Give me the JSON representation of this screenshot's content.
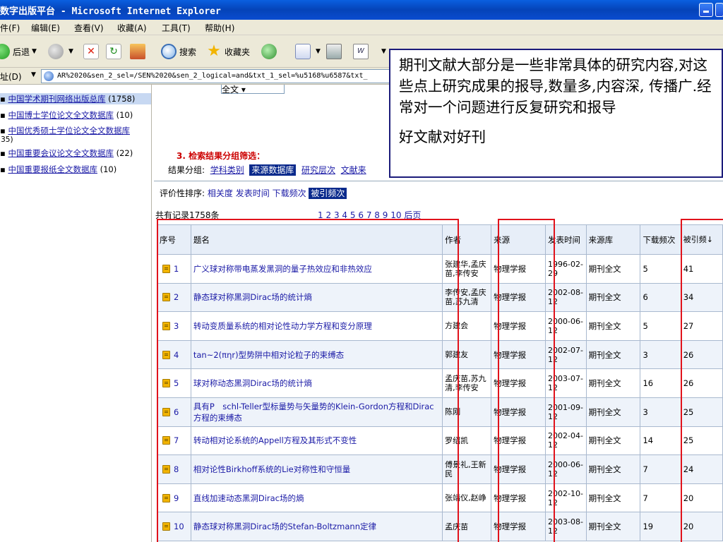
{
  "window": {
    "title": "数字出版平台 - Microsoft Internet Explorer"
  },
  "menu": [
    "件(F)",
    "编辑(E)",
    "查看(V)",
    "收藏(A)",
    "工具(T)",
    "帮助(H)"
  ],
  "toolbar": {
    "back_label": "后退",
    "search_label": "搜索",
    "favorites_label": "收藏夹"
  },
  "address": {
    "label": "址(D)",
    "url": "AR%2020&sen_2_sel=/SEN%2020&sen_2_logical=and&txt_1_sel=%u5168%u6587&txt_"
  },
  "sidebar": {
    "items": [
      {
        "label": "中国学术期刊网络出版总库",
        "count": "(1758)",
        "selected": true
      },
      {
        "label": "中国博士学位论文全文数据库",
        "count": "(10)"
      },
      {
        "label": "中国优秀硕士学位论文全文数据库",
        "count": "(35)"
      },
      {
        "label": "中国重要会议论文全文数据库",
        "count": "(22)"
      },
      {
        "label": "中国重要报纸全文数据库",
        "count": "(10)"
      }
    ]
  },
  "filter": {
    "select_value": "全文",
    "group_title": "3. 检索结果分组筛选：",
    "group_label": "结果分组:",
    "group_items": [
      "学科类别",
      "来源数据库",
      "研究层次",
      "文献来"
    ],
    "group_active": "来源数据库"
  },
  "sort": {
    "label": "评价性排序:",
    "options": [
      "相关度",
      "发表时间",
      "下载频次",
      "被引频次"
    ],
    "active": "被引频次"
  },
  "results": {
    "count_text": "共有记录1758条",
    "pages": [
      "1",
      "2",
      "3",
      "4",
      "5",
      "6",
      "7",
      "8",
      "9",
      "10"
    ],
    "next_label": "后页",
    "headers": [
      "序号",
      "题名",
      "作者",
      "来源",
      "发表时间",
      "来源库",
      "下载频次",
      "被引频↓"
    ],
    "rows": [
      {
        "no": "1",
        "title": "广义球对称带电蒸发黑洞的量子热效应和非热效应",
        "author": "张建华,孟庆苗,李传安",
        "source": "物理学报",
        "date": "1996-02-29",
        "db": "期刊全文",
        "downloads": "5",
        "cites": "41"
      },
      {
        "no": "2",
        "title": "静态球对称黑洞Dirac场的统计熵",
        "author": "李传安,孟庆苗,苏九清",
        "source": "物理学报",
        "date": "2002-08-12",
        "db": "期刊全文",
        "downloads": "6",
        "cites": "34"
      },
      {
        "no": "3",
        "title": "转动变质量系统的相对论性动力学方程和变分原理",
        "author": "方建会",
        "source": "物理学报",
        "date": "2000-06-12",
        "db": "期刊全文",
        "downloads": "5",
        "cites": "27"
      },
      {
        "no": "4",
        "title": "tan~2(πηr)型势阱中相对论粒子的束缚态",
        "author": "郭建友",
        "source": "物理学报",
        "date": "2002-07-12",
        "db": "期刊全文",
        "downloads": "3",
        "cites": "26"
      },
      {
        "no": "5",
        "title": "球对称动态黑洞Dirac场的统计熵",
        "author": "孟庆苗,苏九清,李传安",
        "source": "物理学报",
        "date": "2003-07-12",
        "db": "期刊全文",
        "downloads": "16",
        "cites": "26"
      },
      {
        "no": "6",
        "title": "具有P　schl-Teller型标量势与矢量势的Klein-Gordon方程和Dirac方程的束缚态",
        "author": "陈刚",
        "source": "物理学报",
        "date": "2001-09-12",
        "db": "期刊全文",
        "downloads": "3",
        "cites": "25"
      },
      {
        "no": "7",
        "title": "转动相对论系统的Appell方程及其形式不变性",
        "author": "罗绍凯",
        "source": "物理学报",
        "date": "2002-04-12",
        "db": "期刊全文",
        "downloads": "14",
        "cites": "25"
      },
      {
        "no": "8",
        "title": "相对论性Birkhoff系统的Lie对称性和守恒量",
        "author": "傅景礼,王新民",
        "source": "物理学报",
        "date": "2000-06-12",
        "db": "期刊全文",
        "downloads": "7",
        "cites": "24"
      },
      {
        "no": "9",
        "title": "直线加速动态黑洞Dirac场的熵",
        "author": "张靖仪,赵峥",
        "source": "物理学报",
        "date": "2002-10-12",
        "db": "期刊全文",
        "downloads": "7",
        "cites": "20"
      },
      {
        "no": "10",
        "title": "静态球对称黑洞Dirac场的Stefan-Boltzmann定律",
        "author": "孟庆苗",
        "source": "物理学报",
        "date": "2003-08-12",
        "db": "期刊全文",
        "downloads": "19",
        "cites": "20"
      }
    ]
  },
  "callout": {
    "paragraph1": "期刊文献大部分是一些非常具体的研究内容,对这些点上研究成果的报导,数量多,内容深, 传播广.经常对一个问题进行反复研究和报导",
    "paragraph2": "好文献对好刊"
  },
  "colors": {
    "highlight": "#e1121b",
    "link": "#1a1aa6",
    "active_tab": "#0a2a8c",
    "callout_border": "#1b1b7a"
  }
}
